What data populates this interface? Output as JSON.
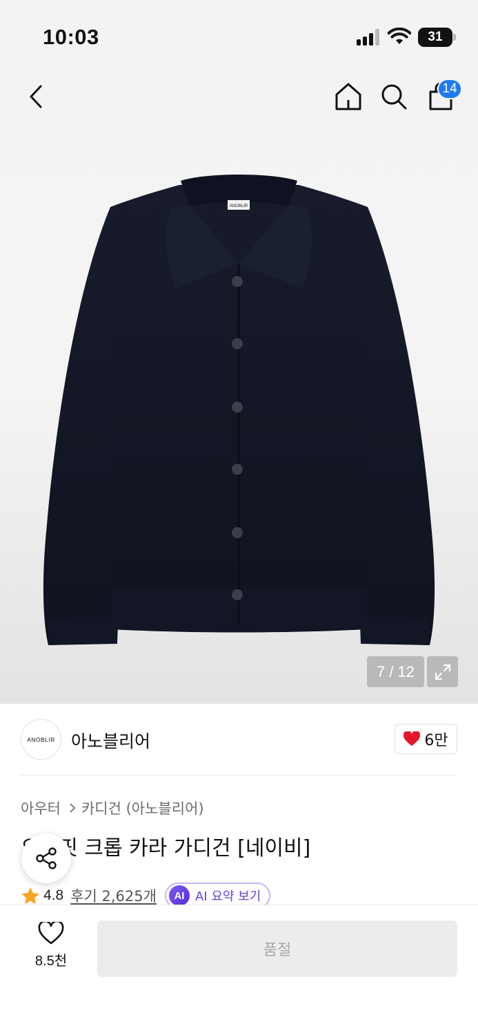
{
  "status_bar": {
    "time": "10:03",
    "battery": "31"
  },
  "header": {
    "cart_count": "14"
  },
  "gallery": {
    "pager": "7 / 12",
    "label_text": "ANOBLIR"
  },
  "brand": {
    "logo_text": "ANOBLIR",
    "name": "아노블리어",
    "likes": "6만"
  },
  "breadcrumb": {
    "level1": "아우터",
    "level2": "카디건 (아노블리어)"
  },
  "product": {
    "title": "오버핏 크롭 카라 가디건 [네이비]"
  },
  "rating": {
    "score": "4.8",
    "reviews": "후기 2,625개",
    "ai_badge": "AI",
    "ai_label": "AI 요약 보기"
  },
  "bottom": {
    "wish_count": "8.5천",
    "buy_label": "품절"
  },
  "colors": {
    "accent_blue": "#1d7bf0",
    "heart_red": "#e4162b",
    "star": "#f6a623",
    "ai_purple": "#6a3fe0",
    "garment_navy": "#141827"
  }
}
